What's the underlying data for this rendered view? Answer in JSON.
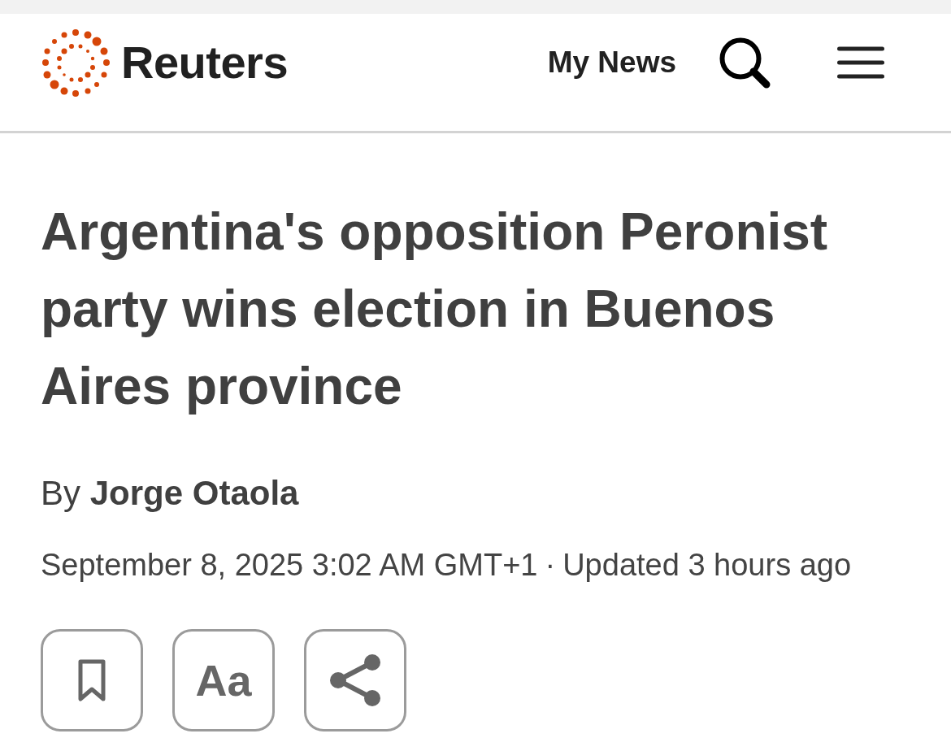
{
  "header": {
    "logo": {
      "brand": "Reuters"
    },
    "nav_links": [
      {
        "label": "My News"
      }
    ],
    "actions": [
      {
        "kind": "search"
      },
      {
        "kind": "menu"
      }
    ]
  },
  "article": {
    "headline": "Argentina's opposition Peronist party wins election in Buenos Aires province",
    "byline": "By **Jorge Otaola**",
    "published": "September 8, 2025 3:02 AM GMT+1",
    "separator": "·",
    "updated": "Updated 3 hours ago",
    "tools": [
      {
        "kind": "bookmark"
      },
      {
        "kind": "text-size",
        "label": "Aa"
      },
      {
        "kind": "share"
      }
    ]
  }
}
